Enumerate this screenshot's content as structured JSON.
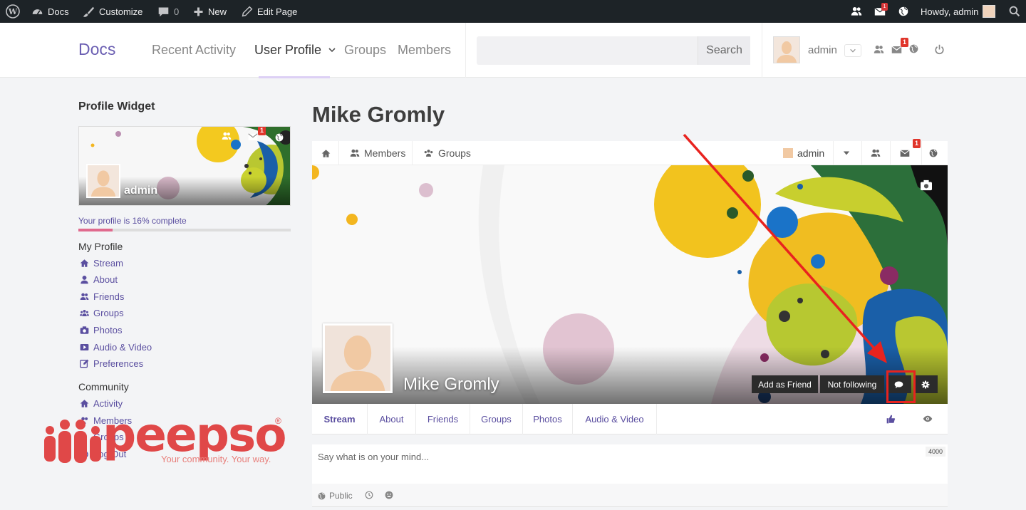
{
  "adminbar": {
    "site": "Docs",
    "customize": "Customize",
    "comments_count": "0",
    "new": "New",
    "edit_page": "Edit Page",
    "messages_badge": "1",
    "howdy": "Howdy, admin"
  },
  "header": {
    "brand": "Docs",
    "nav": [
      "Recent Activity",
      "User Profile",
      "Groups",
      "Members"
    ],
    "search_placeholder": "",
    "search_button": "Search",
    "username": "admin",
    "messages_badge": "1"
  },
  "sidebar": {
    "widget_title": "Profile Widget",
    "widget_username": "admin",
    "widget_badge": "1",
    "completion_text": "Your profile is 16% complete",
    "completion_value": 0.16,
    "my_profile_heading": "My Profile",
    "my_profile_links": [
      "Stream",
      "About",
      "Friends",
      "Groups",
      "Photos",
      "Audio & Video",
      "Preferences"
    ],
    "community_heading": "Community",
    "community_links": [
      "Activity",
      "Members",
      "Groups",
      "Log Out"
    ]
  },
  "watermark": {
    "logo": "peepso",
    "registered": "®",
    "tagline": "Your community. Your way."
  },
  "main": {
    "title": "Mike Gromly",
    "bar": {
      "members": "Members",
      "groups": "Groups",
      "user": "admin",
      "badge": "1"
    },
    "cover": {
      "name": "Mike Gromly",
      "add_friend": "Add as Friend",
      "following": "Not following"
    },
    "tabs": [
      "Stream",
      "About",
      "Friends",
      "Groups",
      "Photos",
      "Audio & Video"
    ],
    "postbox": {
      "placeholder": "Say what is on your mind...",
      "char_limit": "4000",
      "privacy": "Public"
    }
  },
  "colors": {
    "accent": "#5b4fa0",
    "brand": "#6b5fb2",
    "adminbar": "#1d2327",
    "badge": "#e0352b",
    "highlight": "#e8231f"
  }
}
